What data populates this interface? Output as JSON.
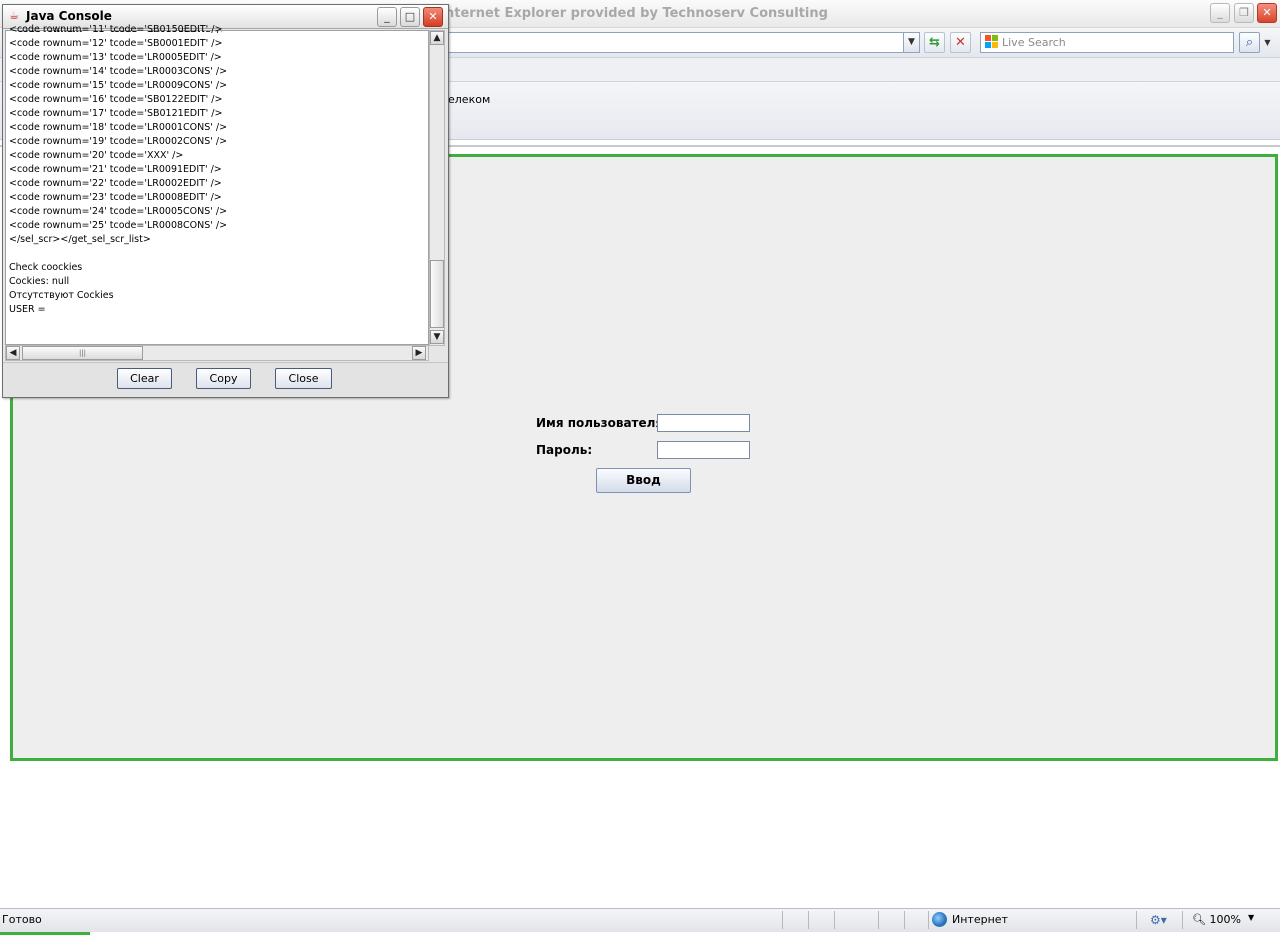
{
  "browser": {
    "title": "nternet Explorer provided by Technoserv Consulting",
    "search_placeholder": "Live Search",
    "page_company_text": "елеком",
    "status_text": "Готово",
    "zone_text": "Интернет",
    "zoom_text": "100%"
  },
  "applet": {
    "username_label": "Имя пользователя:",
    "password_label": "Пароль:",
    "login_button": "Ввод",
    "username_value": "",
    "password_value": ""
  },
  "java_console": {
    "title": "Java Console",
    "lines": [
      "<code rownum='11' tcode='SB0150EDIT' />",
      "<code rownum='12' tcode='SB0001EDIT' />",
      "<code rownum='13' tcode='LR0005EDIT' />",
      "<code rownum='14' tcode='LR0003CONS' />",
      "<code rownum='15' tcode='LR0009CONS' />",
      "<code rownum='16' tcode='SB0122EDIT' />",
      "<code rownum='17' tcode='SB0121EDIT' />",
      "<code rownum='18' tcode='LR0001CONS' />",
      "<code rownum='19' tcode='LR0002CONS' />",
      "<code rownum='20' tcode='XXX' />",
      "<code rownum='21' tcode='LR0091EDIT' />",
      "<code rownum='22' tcode='LR0002EDIT' />",
      "<code rownum='23' tcode='LR0008EDIT' />",
      "<code rownum='24' tcode='LR0005CONS' />",
      "<code rownum='25' tcode='LR0008CONS' />",
      "</sel_scr></get_sel_scr_list>",
      "",
      "Check coockies",
      "Cockies: null",
      "Отсутствуют Cockies",
      "USER ="
    ],
    "buttons": {
      "clear": "Clear",
      "copy": "Copy",
      "close": "Close"
    }
  },
  "colors": {
    "applet_border": "#3fae3f",
    "close_button": "#d9452a"
  }
}
